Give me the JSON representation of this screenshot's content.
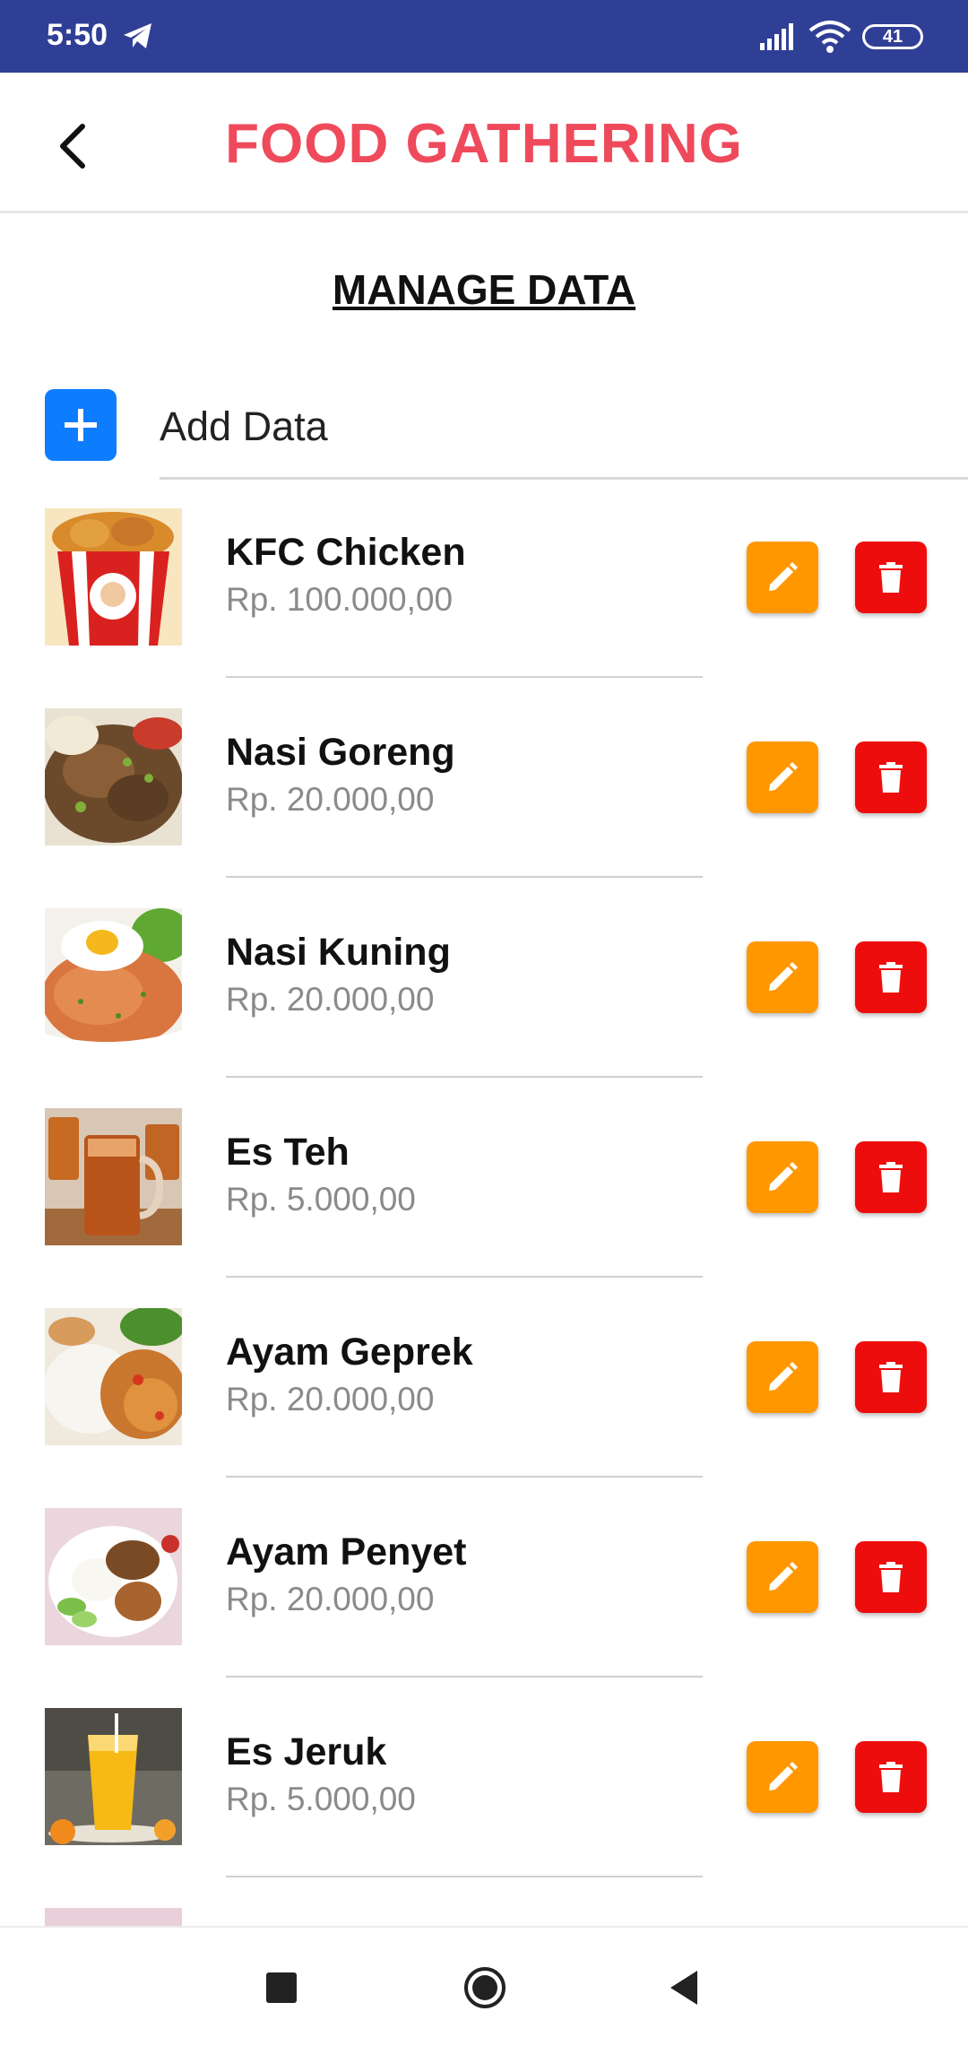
{
  "status_bar": {
    "time": "5:50",
    "battery": "41",
    "icons": [
      "telegram-icon",
      "signal-icon",
      "wifi-icon",
      "battery-icon"
    ]
  },
  "app_bar": {
    "title": "FOOD GATHERING",
    "back_icon": "chevron-left-icon"
  },
  "section": {
    "title": "MANAGE DATA"
  },
  "add": {
    "label": "Add Data",
    "icon": "plus-icon"
  },
  "foods": [
    {
      "name": "KFC Chicken",
      "price": "Rp. 100.000,00"
    },
    {
      "name": "Nasi Goreng",
      "price": "Rp. 20.000,00"
    },
    {
      "name": "Nasi Kuning",
      "price": "Rp. 20.000,00"
    },
    {
      "name": "Es Teh",
      "price": "Rp. 5.000,00"
    },
    {
      "name": "Ayam Geprek",
      "price": "Rp. 20.000,00"
    },
    {
      "name": "Ayam Penyet",
      "price": "Rp. 20.000,00"
    },
    {
      "name": "Es Jeruk",
      "price": "Rp. 5.000,00"
    }
  ],
  "colors": {
    "status_bar": "#303f96",
    "title": "#ef4a5c",
    "add_button": "#0d7cff",
    "edit_button": "#ff9800",
    "delete_button": "#ee0d0d"
  },
  "nav_bar": {
    "icons": [
      "recents-icon",
      "home-icon",
      "back-triangle-icon"
    ]
  }
}
